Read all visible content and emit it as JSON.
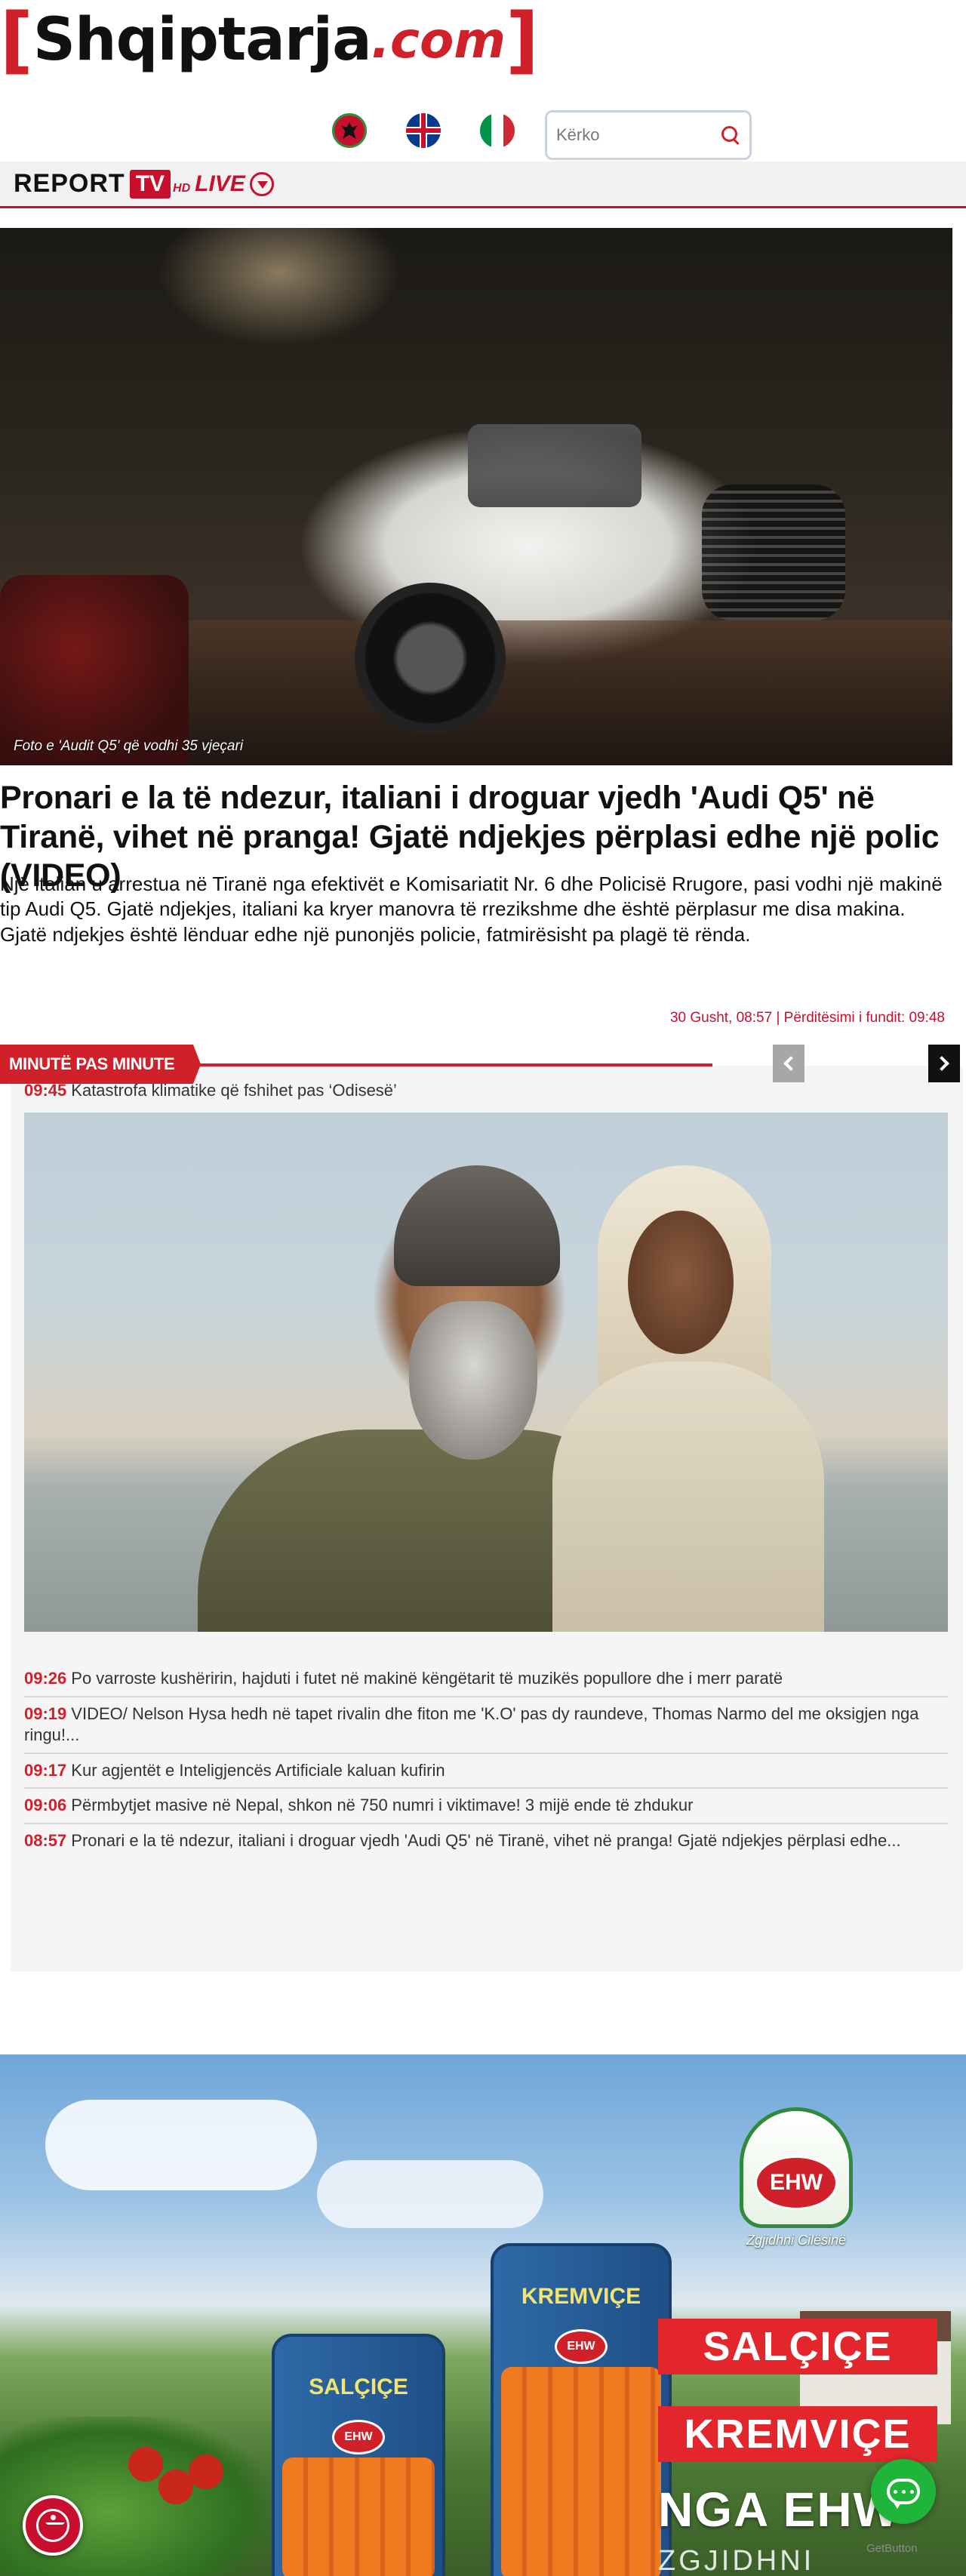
{
  "header": {
    "logo": {
      "open_bracket": "[",
      "name": "Shqiptarja",
      "domain": ".com",
      "close_bracket": "]"
    },
    "languages": [
      {
        "name": "Albanian",
        "icon": "albania-flag-icon"
      },
      {
        "name": "English",
        "icon": "uk-flag-icon"
      },
      {
        "name": "Italian",
        "icon": "italy-flag-icon"
      }
    ],
    "search": {
      "placeholder": "Kërko",
      "value": "",
      "icon": "search-icon"
    }
  },
  "tv_bar": {
    "report": "REPORT",
    "tv": "TV",
    "hd": "HD",
    "live": "LIVE",
    "icon": "chevron-down-icon"
  },
  "article": {
    "image_caption": "Foto e 'Audit Q5' që vodhi 35 vjeçari",
    "title": "Pronari e la të ndezur, italiani i droguar vjedh 'Audi Q5' në Tiranë, vihet në pranga! Gjatë ndjekjes përplasi edhe një polic (VIDEO)",
    "lead": "Një italian u arrestua në Tiranë nga efektivët e Komisariatit Nr. 6 dhe Policisë Rrugore, pasi vodhi një makinë tip Audi Q5. Gjatë ndjekjes, italiani ka kryer manovra të rrezikshme dhe është përplasur me disa makina. Gjatë ndjekjes është lënduar edhe një punonjës policie, fatmirësisht pa plagë të rënda.",
    "meta": "30 Gusht, 08:57 | Përditësimi i fundit: 09:48"
  },
  "minute_by_minute": {
    "heading": "MINUTË PAS MINUTE",
    "featured": {
      "time": "09:45",
      "title": "Katastrofa klimatike që fshihet pas ‘Odisesë’"
    },
    "items": [
      {
        "time": "09:26",
        "title": "Po varroste kushëririn, hajduti i futet në makinë këngëtarit të muzikës popullore dhe i merr paratë"
      },
      {
        "time": "09:19",
        "title": "VIDEO/ Nelson Hysa hedh në tapet rivalin dhe fiton me 'K.O' pas dy raundeve, Thomas Narmo del me oksigjen nga ringu!..."
      },
      {
        "time": "09:17",
        "title": "Kur agjentët e Inteligjencës Artificiale kaluan kufirin"
      },
      {
        "time": "09:06",
        "title": "Përmbytjet masive në Nepal, shkon në 750 numri i viktimave! 3 mijë ende të zhdukur"
      },
      {
        "time": "08:57",
        "title": "Pronari e la të ndezur, italiani i droguar vjedh 'Audi Q5' në Tiranë, vihet në pranga! Gjatë ndjekjes përplasi edhe..."
      }
    ]
  },
  "ad": {
    "pack_left": "SALÇIÇE",
    "pack_right": "KREMVIÇE",
    "brand": "EHW",
    "brand_slogan": "Zgjidhni Cilësinë",
    "line_1": "SALÇIÇE",
    "line_2": "KREMVIÇE",
    "line_3": "NGA EHW",
    "line_4": "ZGJIDHNI CILËSINË"
  },
  "widgets": {
    "accessibility_icon": "accessibility-icon",
    "chat_icon": "chat-icon",
    "getbutton": "GetButton"
  },
  "colors": {
    "brand_red": "#d0202a",
    "text": "#111111",
    "panel_bg": "#f5f5f5"
  }
}
